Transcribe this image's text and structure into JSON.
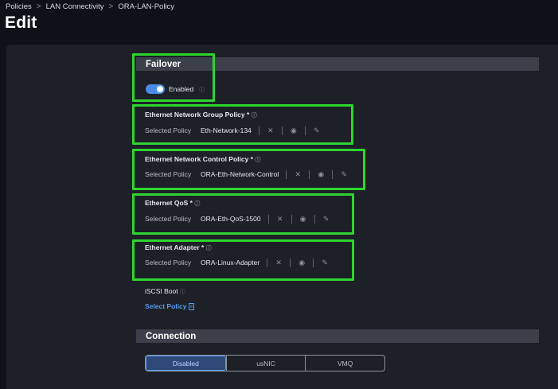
{
  "breadcrumb": {
    "items": [
      "Policies",
      "LAN Connectivity",
      "ORA-LAN-Policy"
    ],
    "separator": ">"
  },
  "page": {
    "title": "Edit"
  },
  "failover": {
    "header": "Failover",
    "toggle_label": "Enabled",
    "toggle_on": true,
    "info": "ⓘ"
  },
  "policies": [
    {
      "label": "Ethernet Network Group Policy *",
      "selected_label": "Selected Policy",
      "value": "Eth-Network-134"
    },
    {
      "label": "Ethernet Network Control Policy *",
      "selected_label": "Selected Policy",
      "value": "ORA-Eth-Network-Control"
    },
    {
      "label": "Ethernet QoS *",
      "selected_label": "Selected Policy",
      "value": "ORA-Eth-QoS-1500"
    },
    {
      "label": "Ethernet Adapter *",
      "selected_label": "Selected Policy",
      "value": "ORA-Linux-Adapter"
    }
  ],
  "iscsi": {
    "label": "iSCSI Boot",
    "select_link": "Select Policy"
  },
  "connection": {
    "header": "Connection",
    "options": [
      "Disabled",
      "usNIC",
      "VMQ"
    ],
    "selected": "Disabled"
  },
  "icons": {
    "info": "info-icon",
    "clear": "close-icon",
    "view": "eye-icon",
    "edit": "pencil-icon",
    "select": "document-icon",
    "chevron": "chevron-right-icon"
  },
  "colors": {
    "highlight": "#2fd52f",
    "accent": "#4b8de6",
    "link": "#5a9cf0",
    "panel": "#1d2027",
    "header_bar": "#3b404b",
    "background": "#0e1117"
  }
}
